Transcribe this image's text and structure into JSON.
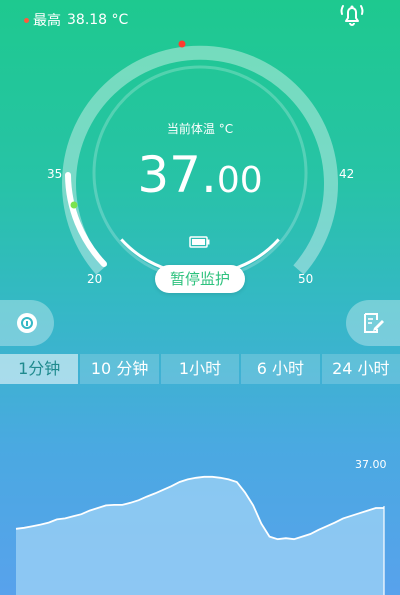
{
  "header": {
    "max_label": "最高",
    "max_value": "38.18 °C",
    "bell_icon": "bell-icon"
  },
  "gauge": {
    "title": "当前体温 °C",
    "value_int": "37.",
    "value_dec": "00",
    "current": 37.0,
    "max_marker": 38.18,
    "range": [
      20,
      50
    ],
    "min_label": "20",
    "max_label": "50",
    "left_label": "35",
    "right_label": "42",
    "battery_icon": "battery-icon",
    "colors": {
      "accent": "#2fc27e",
      "max_dot": "#ff3b30",
      "min_dot": "#7be34f"
    }
  },
  "pause_button": "暂停监护",
  "info_button": {
    "icon": "info-icon"
  },
  "notes_button": {
    "icon": "note-edit-icon"
  },
  "tabs": [
    {
      "label": "1分钟",
      "active": true
    },
    {
      "label": "10 分钟",
      "active": false
    },
    {
      "label": "1小时",
      "active": false
    },
    {
      "label": "6 小时",
      "active": false
    },
    {
      "label": "24 小时",
      "active": false
    }
  ],
  "chart_data": {
    "type": "area",
    "series": [
      {
        "values": [
          36.6,
          36.62,
          36.65,
          36.68,
          36.72,
          36.78,
          36.8,
          36.84,
          36.88,
          36.95,
          37.0,
          37.05,
          37.06,
          37.06,
          37.1,
          37.15,
          37.22,
          37.28,
          37.35,
          37.42,
          37.5,
          37.55,
          37.58,
          37.6,
          37.6,
          37.58,
          37.55,
          37.5,
          37.3,
          37.05,
          36.7,
          36.45,
          36.4,
          36.42,
          36.4,
          36.45,
          36.5,
          36.58,
          36.65,
          36.72,
          36.8,
          36.85,
          36.9,
          36.95,
          37.0,
          37.0
        ]
      }
    ],
    "last_value_label": "37.00",
    "colors": {
      "fill": "#9fd3f5",
      "line": "#ffffff"
    }
  }
}
